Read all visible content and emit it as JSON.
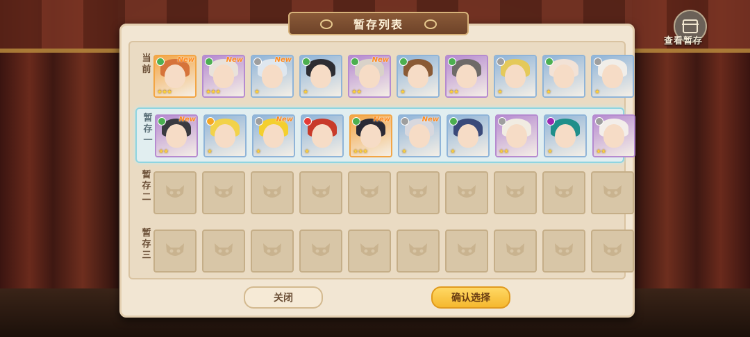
{
  "title": "暂存列表",
  "view_stash_label": "查看暂存",
  "buttons": {
    "close": "关闭",
    "confirm": "确认选择"
  },
  "rows": [
    {
      "label": "当前",
      "slots": [
        {
          "new": "New",
          "stars": "★★★",
          "bg": "#f3a544",
          "hair": "#d6733a",
          "elem": "#4caf50"
        },
        {
          "new": "New",
          "stars": "★★★",
          "bg": "#b58ad0",
          "hair": "#e9e2da",
          "elem": "#4caf50"
        },
        {
          "new": "New",
          "stars": "★",
          "bg": "#8fb4d8",
          "hair": "#dfe7ef",
          "elem": "#9e9e9e"
        },
        {
          "new": "",
          "stars": "★",
          "bg": "#8fb4d8",
          "hair": "#2d2d33",
          "elem": "#4caf50"
        },
        {
          "new": "New",
          "stars": "★★",
          "bg": "#b58ad0",
          "hair": "#d9d2c9",
          "elem": "#4caf50"
        },
        {
          "new": "",
          "stars": "★",
          "bg": "#8fb4d8",
          "hair": "#8a5a35",
          "elem": "#4caf50"
        },
        {
          "new": "",
          "stars": "★★",
          "bg": "#b58ad0",
          "hair": "#6e6a68",
          "elem": "#4caf50"
        },
        {
          "new": "",
          "stars": "★",
          "bg": "#8fb4d8",
          "hair": "#e4c95a",
          "elem": "#9e9e9e"
        },
        {
          "new": "",
          "stars": "★",
          "bg": "#8fb4d8",
          "hair": "#f2e2d6",
          "elem": "#4caf50"
        },
        {
          "new": "",
          "stars": "★",
          "bg": "#8fb4d8",
          "hair": "#f1eee9",
          "elem": "#9e9e9e"
        }
      ]
    },
    {
      "label": "暂存一",
      "slots": [
        {
          "new": "New",
          "stars": "★★",
          "bg": "#b58ad0",
          "hair": "#3a3a40",
          "elem": "#4caf50"
        },
        {
          "new": "",
          "stars": "★",
          "bg": "#8fb4d8",
          "hair": "#f2d24a",
          "elem": "#f5a623"
        },
        {
          "new": "New",
          "stars": "★",
          "bg": "#8fb4d8",
          "hair": "#f4cf2e",
          "elem": "#9e9e9e"
        },
        {
          "new": "",
          "stars": "★",
          "bg": "#8fb4d8",
          "hair": "#c83a2a",
          "elem": "#e53935"
        },
        {
          "new": "New",
          "stars": "★★★",
          "bg": "#f3a544",
          "hair": "#2a2a35",
          "elem": "#4caf50"
        },
        {
          "new": "New",
          "stars": "★",
          "bg": "#8fb4d8",
          "hair": "#d8d8de",
          "elem": "#9e9e9e"
        },
        {
          "new": "",
          "stars": "★",
          "bg": "#8fb4d8",
          "hair": "#3a4a7a",
          "elem": "#4caf50"
        },
        {
          "new": "",
          "stars": "★★",
          "bg": "#b58ad0",
          "hair": "#f1ece2",
          "elem": "#9e9e9e"
        },
        {
          "new": "",
          "stars": "★",
          "bg": "#8fb4d8",
          "hair": "#1f8f8a",
          "elem": "#9c27b0"
        },
        {
          "new": "",
          "stars": "★★",
          "bg": "#b58ad0",
          "hair": "#f3eeea",
          "elem": "#9e9e9e"
        }
      ]
    },
    {
      "label": "暂存二",
      "slots": []
    },
    {
      "label": "暂存三",
      "slots": []
    }
  ],
  "colors": {
    "panel": "#f2e6d3",
    "confirm": "#f5b82e",
    "selected_row": "#8fd4e0"
  }
}
